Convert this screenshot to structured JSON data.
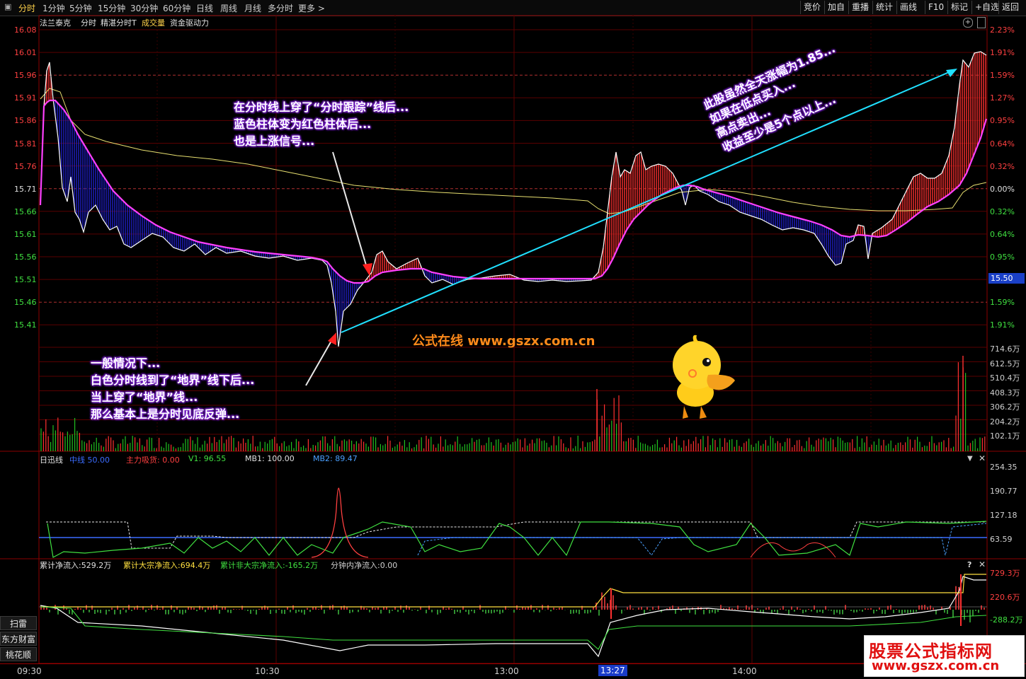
{
  "toolbar": {
    "left_items": [
      "分时",
      "1分钟",
      "5分钟",
      "15分钟",
      "30分钟",
      "60分钟",
      "日线",
      "周线",
      "月线",
      "多分时",
      "更多 >"
    ],
    "right_items": [
      "竞价",
      "加自",
      "重播",
      "统计",
      "画线",
      "F10",
      "标记",
      "+自选",
      "返回"
    ]
  },
  "header": {
    "stock_name": "法兰泰克",
    "items": [
      "分时",
      "精湛分时T",
      "成交量",
      "资金驱动力"
    ]
  },
  "price_axis": {
    "left": [
      "16.08",
      "16.01",
      "15.96",
      "15.91",
      "15.86",
      "15.81",
      "15.76",
      "15.71",
      "15.66",
      "15.61",
      "15.56",
      "15.51",
      "15.46",
      "15.41"
    ],
    "right": [
      "2.23%",
      "1.91%",
      "1.59%",
      "1.27%",
      "0.95%",
      "0.64%",
      "0.32%",
      "0.00%",
      "0.32%",
      "0.64%",
      "0.95%",
      "1.27%",
      "1.59%",
      "1.91%"
    ],
    "current_price": "15.50"
  },
  "volume_axis": [
    "714.6万",
    "612.5万",
    "510.4万",
    "408.3万",
    "306.2万",
    "204.2万",
    "102.1万"
  ],
  "indicator1": {
    "name": "日迅线",
    "params": [
      {
        "label": "中线",
        "value": "50.00",
        "color": "#3b6cff"
      },
      {
        "label": "主力吸货",
        "value": "0.00",
        "color": "#ff4040"
      },
      {
        "label": "V1",
        "value": "96.55",
        "color": "#40e040"
      },
      {
        "label": "MB1",
        "value": "100.00",
        "color": "#e0e0e0"
      },
      {
        "label": "MB2",
        "value": "89.47",
        "color": "#4aa0ff"
      }
    ],
    "axis": [
      "254.35",
      "190.77",
      "127.18",
      "63.59"
    ]
  },
  "indicator2": {
    "params": [
      {
        "text": "累计净流入:529.2万",
        "color": "#e0e0e0"
      },
      {
        "text": "累计大宗净流入:694.4万",
        "color": "#ffe040"
      },
      {
        "text": "累计非大宗净流入:-165.2万",
        "color": "#40e040"
      },
      {
        "text": "分钟内净流入:0.00",
        "color": "#d0d0d0"
      }
    ],
    "axis": [
      "729.3万",
      "220.6万",
      "-288.2万"
    ]
  },
  "side_buttons": [
    "扫雷",
    "东方财富",
    "桃花顺"
  ],
  "x_axis": {
    "labels": [
      "09:30",
      "10:30",
      "13:00",
      "14:00"
    ],
    "cursor_time": "13:27"
  },
  "annotations": {
    "top_middle": [
      "在分时线上穿了“分时跟踪”线后...",
      "蓝色柱体变为红色柱体后...",
      "也是上涨信号..."
    ],
    "top_right": [
      "此股虽然全天涨幅为1.85...",
      "如果在低点买入...",
      "高点卖出...",
      "收益至少是5个点以上..."
    ],
    "bottom_left": [
      "一般情况下...",
      "白色分时线到了“地界”线下后...",
      "当上穿了“地界”线...",
      "那么基本上是分时见底反弹..."
    ]
  },
  "watermarks": {
    "center": "公式在线 www.gszx.com.cn",
    "corner_title": "股票公式指标网",
    "corner_url": "www.gszx.com.cn"
  },
  "colors": {
    "up": "#ff3030",
    "down": "#2020c0",
    "track_line": "#ff40ff",
    "price_line": "#ffffff",
    "avg_line": "#e8e070",
    "arrow": "#20e0ff",
    "grid_red": "#8b0000"
  }
}
